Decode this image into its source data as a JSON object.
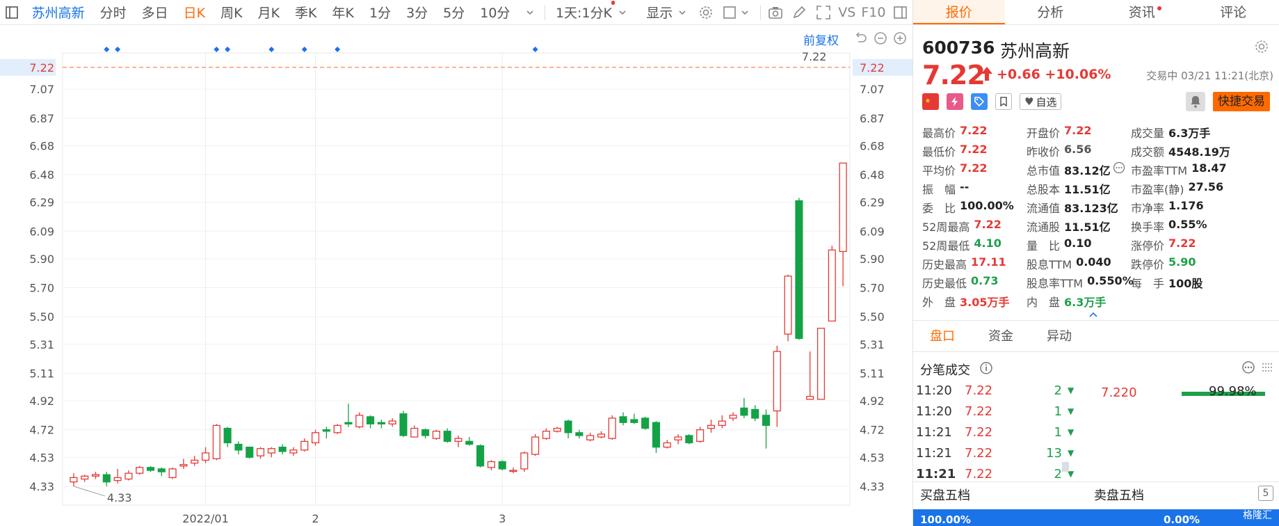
{
  "toolbar": {
    "stock": "苏州高新",
    "periods": [
      {
        "label": "分时",
        "active": false
      },
      {
        "label": "多日",
        "active": false
      },
      {
        "label": "日K",
        "active": true
      },
      {
        "label": "周K",
        "active": false
      },
      {
        "label": "月K",
        "active": false
      },
      {
        "label": "季K",
        "active": false
      },
      {
        "label": "年K",
        "active": false
      },
      {
        "label": "1分",
        "active": false
      },
      {
        "label": "3分",
        "active": false
      },
      {
        "label": "5分",
        "active": false
      },
      {
        "label": "10分",
        "active": false
      }
    ],
    "range": "1天:1分K",
    "display": "显示",
    "vs": "VS",
    "f10": "F10"
  },
  "chart_data": {
    "type": "candlestick",
    "ylim": [
      4.2,
      7.32
    ],
    "yticks": [
      4.33,
      4.53,
      4.72,
      4.92,
      5.11,
      5.31,
      5.5,
      5.7,
      5.9,
      6.09,
      6.29,
      6.48,
      6.68,
      6.87,
      7.07
    ],
    "ytick_labels": [
      "4.33",
      "4.53",
      "4.72",
      "4.92",
      "5.11",
      "5.31",
      "5.50",
      "5.70",
      "5.90",
      "6.09",
      "6.29",
      "6.48",
      "6.68",
      "6.87",
      "7.07"
    ],
    "current_price": "7.22",
    "current_value": 7.22,
    "top_label": "7.22",
    "low_label": "4.33",
    "xlabels": [
      {
        "label": "2022/01",
        "index": 12
      },
      {
        "label": "2",
        "index": 22
      },
      {
        "label": "3",
        "index": 39
      }
    ],
    "marker_indices": [
      3,
      4,
      13,
      14,
      18,
      21,
      24,
      42
    ],
    "candles": [
      [
        4.36,
        4.39,
        4.42,
        4.33
      ],
      [
        4.38,
        4.4,
        4.41,
        4.36
      ],
      [
        4.4,
        4.41,
        4.43,
        4.38
      ],
      [
        4.41,
        4.36,
        4.43,
        4.33
      ],
      [
        4.37,
        4.39,
        4.45,
        4.35
      ],
      [
        4.38,
        4.42,
        4.44,
        4.37
      ],
      [
        4.42,
        4.46,
        4.47,
        4.41
      ],
      [
        4.46,
        4.44,
        4.47,
        4.43
      ],
      [
        4.45,
        4.43,
        4.46,
        4.4
      ],
      [
        4.39,
        4.45,
        4.46,
        4.38
      ],
      [
        4.47,
        4.48,
        4.52,
        4.45
      ],
      [
        4.49,
        4.51,
        4.54,
        4.47
      ],
      [
        4.51,
        4.56,
        4.6,
        4.49
      ],
      [
        4.52,
        4.75,
        4.76,
        4.51
      ],
      [
        4.73,
        4.63,
        4.74,
        4.6
      ],
      [
        4.62,
        4.58,
        4.64,
        4.55
      ],
      [
        4.6,
        4.53,
        4.6,
        4.52
      ],
      [
        4.54,
        4.59,
        4.6,
        4.52
      ],
      [
        4.56,
        4.59,
        4.6,
        4.53
      ],
      [
        4.6,
        4.57,
        4.62,
        4.55
      ],
      [
        4.56,
        4.58,
        4.6,
        4.54
      ],
      [
        4.58,
        4.64,
        4.66,
        4.57
      ],
      [
        4.63,
        4.7,
        4.72,
        4.61
      ],
      [
        4.72,
        4.71,
        4.74,
        4.66
      ],
      [
        4.7,
        4.75,
        4.76,
        4.69
      ],
      [
        4.77,
        4.76,
        4.9,
        4.74
      ],
      [
        4.74,
        4.82,
        4.84,
        4.73
      ],
      [
        4.81,
        4.76,
        4.82,
        4.73
      ],
      [
        4.77,
        4.76,
        4.79,
        4.73
      ],
      [
        4.76,
        4.78,
        4.8,
        4.74
      ],
      [
        4.83,
        4.68,
        4.85,
        4.67
      ],
      [
        4.67,
        4.73,
        4.75,
        4.67
      ],
      [
        4.72,
        4.68,
        4.73,
        4.66
      ],
      [
        4.66,
        4.71,
        4.72,
        4.65
      ],
      [
        4.71,
        4.64,
        4.73,
        4.63
      ],
      [
        4.64,
        4.66,
        4.68,
        4.6
      ],
      [
        4.64,
        4.62,
        4.67,
        4.61
      ],
      [
        4.61,
        4.47,
        4.62,
        4.46
      ],
      [
        4.46,
        4.5,
        4.51,
        4.44
      ],
      [
        4.5,
        4.45,
        4.51,
        4.44
      ],
      [
        4.44,
        4.44,
        4.46,
        4.42
      ],
      [
        4.45,
        4.56,
        4.57,
        4.43
      ],
      [
        4.55,
        4.67,
        4.69,
        4.54
      ],
      [
        4.66,
        4.71,
        4.73,
        4.65
      ],
      [
        4.71,
        4.73,
        4.74,
        4.7
      ],
      [
        4.78,
        4.7,
        4.79,
        4.66
      ],
      [
        4.7,
        4.68,
        4.72,
        4.66
      ],
      [
        4.65,
        4.68,
        4.7,
        4.64
      ],
      [
        4.67,
        4.69,
        4.71,
        4.66
      ],
      [
        4.66,
        4.8,
        4.82,
        4.65
      ],
      [
        4.81,
        4.77,
        4.84,
        4.75
      ],
      [
        4.79,
        4.77,
        4.83,
        4.76
      ],
      [
        4.8,
        4.73,
        4.81,
        4.72
      ],
      [
        4.77,
        4.6,
        4.78,
        4.56
      ],
      [
        4.6,
        4.63,
        4.65,
        4.59
      ],
      [
        4.65,
        4.67,
        4.69,
        4.62
      ],
      [
        4.68,
        4.63,
        4.69,
        4.62
      ],
      [
        4.64,
        4.72,
        4.74,
        4.63
      ],
      [
        4.73,
        4.75,
        4.79,
        4.7
      ],
      [
        4.75,
        4.78,
        4.82,
        4.73
      ],
      [
        4.8,
        4.82,
        4.84,
        4.78
      ],
      [
        4.87,
        4.82,
        4.94,
        4.8
      ],
      [
        4.86,
        4.8,
        4.89,
        4.78
      ],
      [
        4.82,
        4.75,
        4.86,
        4.59
      ],
      [
        4.85,
        5.26,
        5.3,
        4.74
      ],
      [
        5.38,
        5.78,
        5.79,
        5.33
      ],
      [
        6.3,
        5.35,
        6.32,
        5.34
      ],
      [
        4.93,
        4.95,
        5.26,
        4.93
      ],
      [
        4.93,
        5.42,
        5.42,
        4.93
      ],
      [
        5.47,
        5.96,
        5.99,
        5.47
      ],
      [
        5.95,
        6.56,
        6.56,
        5.71
      ]
    ]
  },
  "panel": {
    "tabs": [
      {
        "label": "报价",
        "active": true,
        "dot": false
      },
      {
        "label": "分析",
        "active": false,
        "dot": false
      },
      {
        "label": "资讯",
        "active": false,
        "dot": true
      },
      {
        "label": "评论",
        "active": false,
        "dot": false
      }
    ],
    "code": "600736",
    "name": "苏州高新",
    "price": "7.22",
    "change": "+0.66 +10.06%",
    "status": "交易中 03/21 11:21(北京)",
    "fav": "自选",
    "quick_trade": "快捷交易",
    "stats": [
      [
        {
          "l": "最高价",
          "v": "7.22",
          "c": "red"
        },
        {
          "l": "开盘价",
          "v": "7.22",
          "c": "red"
        },
        {
          "l": "成交量",
          "v": "6.3万手",
          "c": "blk"
        }
      ],
      [
        {
          "l": "最低价",
          "v": "7.22",
          "c": "red"
        },
        {
          "l": "昨收价",
          "v": "6.56",
          "c": "gray"
        },
        {
          "l": "成交额",
          "v": "4548.19万",
          "c": "blk"
        }
      ],
      [
        {
          "l": "平均价",
          "v": "7.22",
          "c": "red"
        },
        {
          "l": "总市值",
          "v": "83.12亿",
          "c": "blk"
        },
        {
          "l": "市盈率TTM",
          "v": "18.47",
          "c": "blk"
        }
      ],
      [
        {
          "l": "振　幅",
          "v": "--",
          "c": "blk"
        },
        {
          "l": "总股本",
          "v": "11.51亿",
          "c": "blk"
        },
        {
          "l": "市盈率(静)",
          "v": "27.56",
          "c": "blk"
        }
      ],
      [
        {
          "l": "委　比",
          "v": "100.00%",
          "c": "blk"
        },
        {
          "l": "流通值",
          "v": "83.123亿",
          "c": "blk"
        },
        {
          "l": "市净率",
          "v": "1.176",
          "c": "blk"
        }
      ],
      [
        {
          "l": "52周最高",
          "v": "7.22",
          "c": "red"
        },
        {
          "l": "流通股",
          "v": "11.51亿",
          "c": "blk"
        },
        {
          "l": "换手率",
          "v": "0.55%",
          "c": "blk"
        }
      ],
      [
        {
          "l": "52周最低",
          "v": "4.10",
          "c": "green"
        },
        {
          "l": "量　比",
          "v": "0.10",
          "c": "blk"
        },
        {
          "l": "涨停价",
          "v": "7.22",
          "c": "red"
        }
      ],
      [
        {
          "l": "历史最高",
          "v": "17.11",
          "c": "red"
        },
        {
          "l": "股息TTM",
          "v": "0.040",
          "c": "blk"
        },
        {
          "l": "跌停价",
          "v": "5.90",
          "c": "green"
        }
      ],
      [
        {
          "l": "历史最低",
          "v": "0.73",
          "c": "green"
        },
        {
          "l": "股息率TTM",
          "v": "0.550%",
          "c": "blk"
        },
        {
          "l": "每　手",
          "v": "100股",
          "c": "blk"
        }
      ],
      [
        {
          "l": "外　盘",
          "v": "3.05万手",
          "c": "red"
        },
        {
          "l": "内　盘",
          "v": "6.3万手",
          "c": "green"
        },
        {
          "l": "",
          "v": "",
          "c": "blk"
        }
      ]
    ],
    "subtabs": [
      {
        "label": "盘口",
        "active": true
      },
      {
        "label": "资金",
        "active": false
      },
      {
        "label": "异动",
        "active": false
      }
    ],
    "ticks_title": "分笔成交",
    "ticks": [
      {
        "t": "11:20",
        "p": "7.22",
        "v": "2"
      },
      {
        "t": "11:20",
        "p": "7.22",
        "v": "1"
      },
      {
        "t": "11:21",
        "p": "7.22",
        "v": "1"
      },
      {
        "t": "11:21",
        "p": "7.22",
        "v": "13"
      },
      {
        "t": "11:21",
        "p": "7.22",
        "v": "2"
      }
    ],
    "rate_price": "7.220",
    "rate_pct": "99.98%",
    "restore": "前复权",
    "buy": "买盘五档",
    "sell": "卖盘五档",
    "ob_icon": "5",
    "bar_left": "100.00%",
    "bar_right": "0.00%",
    "watermark": "格隆汇"
  }
}
